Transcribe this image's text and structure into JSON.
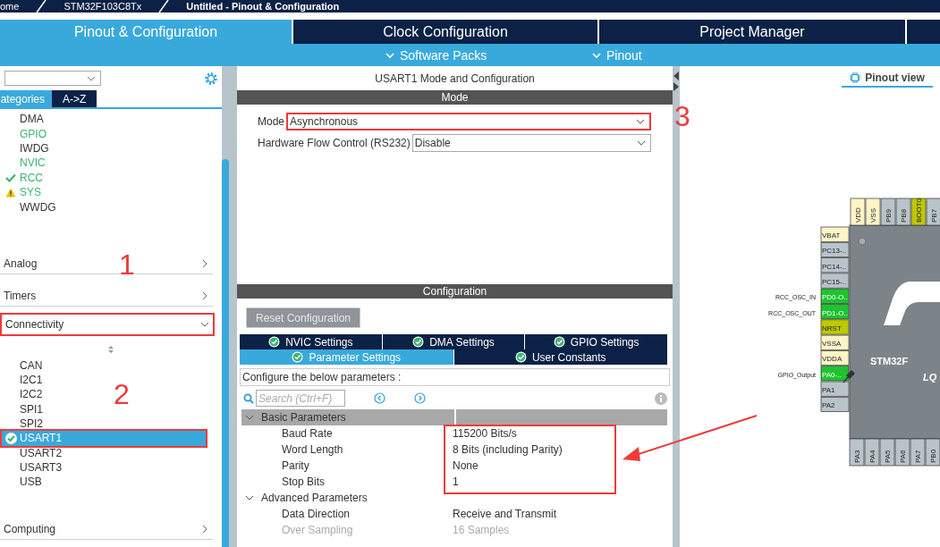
{
  "breadcrumb": [
    "ome",
    "STM32F103C8Tx",
    "Untitled - Pinout & Configuration"
  ],
  "main_tabs": [
    {
      "label": "Pinout & Configuration",
      "selected": true
    },
    {
      "label": "Clock Configuration",
      "selected": false
    },
    {
      "label": "Project Manager",
      "selected": false
    }
  ],
  "sub_menus": [
    "Software Packs",
    "Pinout"
  ],
  "sidebar": {
    "view_tabs": [
      {
        "label": "ategories",
        "selected": true
      },
      {
        "label": "A->Z",
        "selected": false
      }
    ],
    "system_items": [
      {
        "label": "DMA",
        "kind": "plain"
      },
      {
        "label": "GPIO",
        "kind": "active"
      },
      {
        "label": "IWDG",
        "kind": "plain"
      },
      {
        "label": "NVIC",
        "kind": "active"
      },
      {
        "label": "RCC",
        "kind": "ok"
      },
      {
        "label": "SYS",
        "kind": "warning"
      },
      {
        "label": "WWDG",
        "kind": "plain"
      }
    ],
    "groups": [
      {
        "label": "Analog",
        "expanded": false,
        "highlighted": false
      },
      {
        "label": "Timers",
        "expanded": false,
        "highlighted": false
      },
      {
        "label": "Connectivity",
        "expanded": true,
        "highlighted": true,
        "items": [
          {
            "label": "CAN",
            "kind": "plain",
            "selected": false,
            "highlighted": false
          },
          {
            "label": "I2C1",
            "kind": "plain",
            "selected": false,
            "highlighted": false
          },
          {
            "label": "I2C2",
            "kind": "plain",
            "selected": false,
            "highlighted": false
          },
          {
            "label": "SPI1",
            "kind": "plain",
            "selected": false,
            "highlighted": false
          },
          {
            "label": "SPI2",
            "kind": "plain",
            "selected": false,
            "highlighted": false
          },
          {
            "label": "USART1",
            "kind": "ok",
            "selected": true,
            "highlighted": true
          },
          {
            "label": "USART2",
            "kind": "plain",
            "selected": false,
            "highlighted": false
          },
          {
            "label": "USART3",
            "kind": "plain",
            "selected": false,
            "highlighted": false
          },
          {
            "label": "USB",
            "kind": "plain",
            "selected": false,
            "highlighted": false
          }
        ]
      },
      {
        "label": "Computing",
        "expanded": false,
        "highlighted": false
      }
    ]
  },
  "panel": {
    "title": "USART1 Mode and Configuration",
    "mode_header": "Mode",
    "fields": [
      {
        "label": "Mode",
        "value": "Asynchronous",
        "highlighted": true
      },
      {
        "label": "Hardware Flow Control (RS232)",
        "value": "Disable",
        "highlighted": false
      }
    ],
    "config_header": "Configuration",
    "reset_button": "Reset Configuration",
    "tab_rows": [
      [
        {
          "label": "NVIC Settings",
          "selected": false
        },
        {
          "label": "DMA Settings",
          "selected": false
        },
        {
          "label": "GPIO Settings",
          "selected": false
        }
      ],
      [
        {
          "label": "Parameter Settings",
          "selected": true
        },
        {
          "label": "User Constants",
          "selected": false
        }
      ]
    ],
    "hint": "Configure the below parameters :",
    "search_placeholder": "Search (Ctrl+F)",
    "param_groups": [
      {
        "label": "Basic Parameters",
        "expanded": true,
        "highlighted": true,
        "params": [
          {
            "name": "Baud Rate",
            "value": "115200 Bits/s",
            "disabled": false
          },
          {
            "name": "Word Length",
            "value": "8 Bits (including Parity)",
            "disabled": false
          },
          {
            "name": "Parity",
            "value": "None",
            "disabled": false
          },
          {
            "name": "Stop Bits",
            "value": "1",
            "disabled": false
          }
        ]
      },
      {
        "label": "Advanced Parameters",
        "expanded": true,
        "highlighted": false,
        "params": [
          {
            "name": "Data Direction",
            "value": "Receive and Transmit",
            "disabled": false
          },
          {
            "name": "Over Sampling",
            "value": "16 Samples",
            "disabled": true
          }
        ]
      }
    ]
  },
  "pinout": {
    "tab": "Pinout view",
    "top_pins": [
      {
        "label": "VDD",
        "color": "#fff4c8"
      },
      {
        "label": "VSS",
        "color": "#fff4c8"
      },
      {
        "label": "PB9",
        "color": "#b9c4ca"
      },
      {
        "label": "PB8",
        "color": "#b9c4ca"
      },
      {
        "label": "BOOT0",
        "color": "#bfc800"
      },
      {
        "label": "PB7",
        "color": "#b9c4ca"
      }
    ],
    "left_pins": [
      {
        "label": "VBAT",
        "color": "#fff4c8"
      },
      {
        "label": "PC13-..",
        "color": "#b9c4ca"
      },
      {
        "label": "PC14-..",
        "color": "#b9c4ca"
      },
      {
        "label": "PC15-..",
        "color": "#b9c4ca"
      },
      {
        "label": "PD0-O..",
        "color": "#1ec430",
        "signal": "RCC_OSC_IN"
      },
      {
        "label": "PD1-O..",
        "color": "#1ec430",
        "signal": "RCC_OSC_OUT"
      },
      {
        "label": "NRST",
        "color": "#bfc800"
      },
      {
        "label": "VSSA",
        "color": "#fff4c8"
      },
      {
        "label": "VDDA",
        "color": "#fff4c8"
      },
      {
        "label": "PA0-..",
        "color": "#1ec430",
        "signal": "GPIO_Output"
      },
      {
        "label": "PA1",
        "color": "#b9c4ca"
      },
      {
        "label": "PA2",
        "color": "#b9c4ca"
      }
    ],
    "bottom_pins": [
      {
        "label": "PA3",
        "color": "#b9c4ca"
      },
      {
        "label": "PA4",
        "color": "#b9c4ca"
      },
      {
        "label": "PA5",
        "color": "#b9c4ca"
      },
      {
        "label": "PA6",
        "color": "#b9c4ca"
      },
      {
        "label": "PA7",
        "color": "#b9c4ca"
      },
      {
        "label": "PB0",
        "color": "#b9c4ca"
      }
    ],
    "chip_label": "STM32F",
    "chip_sublabel": "LQ"
  },
  "annotations": [
    "1",
    "2",
    "3"
  ]
}
